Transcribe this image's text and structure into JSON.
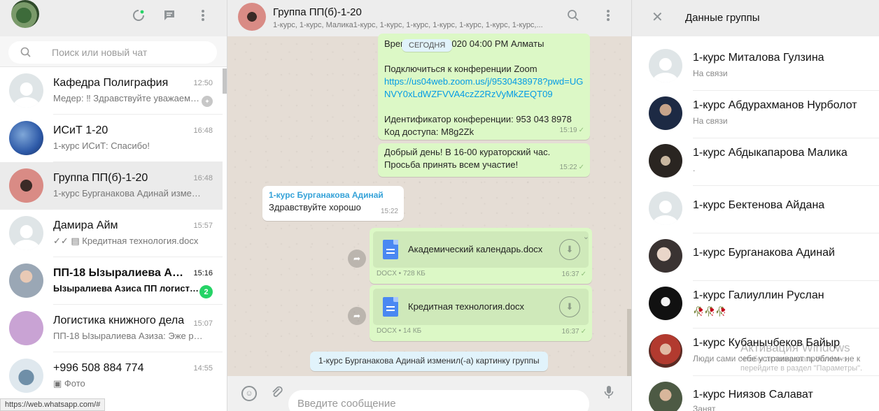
{
  "left": {
    "search_placeholder": "Поиск или новый чат",
    "status_url": "https://web.whatsapp.com/#",
    "chats": [
      {
        "name": "Кафедра Полиграфия",
        "time": "12:50",
        "preview": "Медер: ‼ Здравствуйте уважаемые…",
        "pinned": true
      },
      {
        "name": "ИСиТ 1-20",
        "time": "16:48",
        "preview": "1-курс ИСиТ: Спасибо!"
      },
      {
        "name": "Группа  ПП(б)-1-20",
        "time": "16:48",
        "preview": "1-курс Бурганакова Адинай изменил(-а)…",
        "active": true
      },
      {
        "name": "Дамира Айм",
        "time": "15:57",
        "preview": "✓✓ ▤ Кредитная технология.docx"
      },
      {
        "name": "ПП-18 Ызыралиева Аз...",
        "time": "15:16",
        "preview": "Ызыралиева Азиса ПП логистика…",
        "unread": "2",
        "bold": true
      },
      {
        "name": "Логистика книжного дела",
        "time": "15:07",
        "preview": "ПП-18 Ызыралиева Азиза: Эже разрешите…"
      },
      {
        "name": "+996 508 884 774",
        "time": "14:55",
        "preview": "▣ Фото"
      }
    ]
  },
  "chat": {
    "title": "Группа  ПП(б)-1-20",
    "members": "1-курс, 1-курс, Малика1-курс, 1-курс, 1-курс, 1-курс, 1-курс, 1-курс, 1-курс,...",
    "date_pill": "СЕГОДНЯ",
    "msg1": {
      "line1": "Время: 13 окт. 2020 04:00 PM Алматы",
      "line2": "Подключиться к конференции Zoom",
      "link": "https://us04web.zoom.us/j/9530438978?pwd=UGNVY0xLdWZFVVA4czZ2RzVyMkZEQT09",
      "line3": "Идентификатор конференции: 953 043 8978",
      "line4": "Код доступа: M8g2Zk",
      "time": "15:19"
    },
    "msg2": {
      "text": "Добрый день! В 16-00 кураторский час. Просьба принять всем участие!",
      "time": "15:22"
    },
    "msg3": {
      "sender": "1-курс Бурганакова Адинай",
      "text": "Здравствуйте хорошо",
      "time": "15:22"
    },
    "doc1": {
      "name": "Академический календарь.docx",
      "meta": "DOCX • 728 КБ",
      "time": "16:37"
    },
    "doc2": {
      "name": "Кредитная технология.docx",
      "meta": "DOCX • 14 КБ",
      "time": "16:37"
    },
    "system": "1-курс Бурганакова Адинай изменил(-а) картинку группы",
    "composer_placeholder": "Введите сообщение"
  },
  "right": {
    "title": "Данные группы",
    "members": [
      {
        "name": "1-курс Миталова Гулзина",
        "status": "На связи"
      },
      {
        "name": "1-курс Абдурахманов Нурболот",
        "status": "На связи"
      },
      {
        "name": "1-курс Абдыкапарова Малика",
        "status": "."
      },
      {
        "name": "1-курс Бектенова Айдана",
        "status": ""
      },
      {
        "name": "1-курс Бурганакова Адинай",
        "status": ""
      },
      {
        "name": "1-курс Галиуллин Руслан",
        "status": "🥀🥀🥀"
      },
      {
        "name": "1-курс Кубанычбеков Байыр",
        "status": "Люди сами себе устраивают проблем- не к"
      },
      {
        "name": "1-курс Ниязов Салават",
        "status": "Занят"
      }
    ]
  },
  "watermark": {
    "title": "Активация Windows",
    "sub": "Чтобы активировать Windows, перейдите в раздел \"Параметры\"."
  }
}
